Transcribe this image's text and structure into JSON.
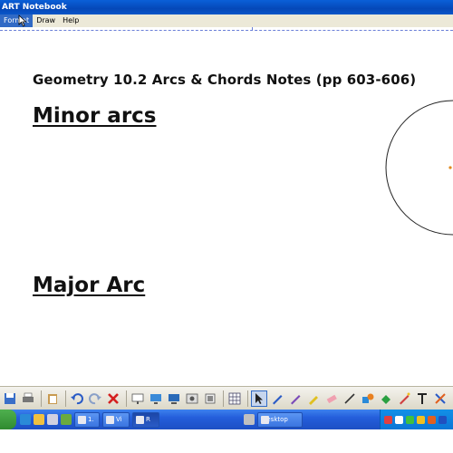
{
  "window": {
    "title": "ART Notebook"
  },
  "menu": {
    "items": [
      {
        "label": "Format",
        "active": true
      },
      {
        "label": "Draw",
        "active": false
      },
      {
        "label": "Help",
        "active": false
      }
    ]
  },
  "page": {
    "heading": "Geometry 10.2 Arcs & Chords Notes (pp 603-606)",
    "minor_arcs": "Minor arcs",
    "major_arc": "Major Arc"
  },
  "taskbar": {
    "buttons": [
      {
        "label": "1."
      },
      {
        "label": "Vi"
      },
      {
        "label": "R"
      },
      {
        "label": "Desktop"
      }
    ]
  },
  "colors": {
    "titlebar": "#0548b8",
    "menubar": "#ece9d8",
    "menu_highlight": "#316ac5",
    "taskbar": "#245edb",
    "circle_center": "#e08a20"
  }
}
